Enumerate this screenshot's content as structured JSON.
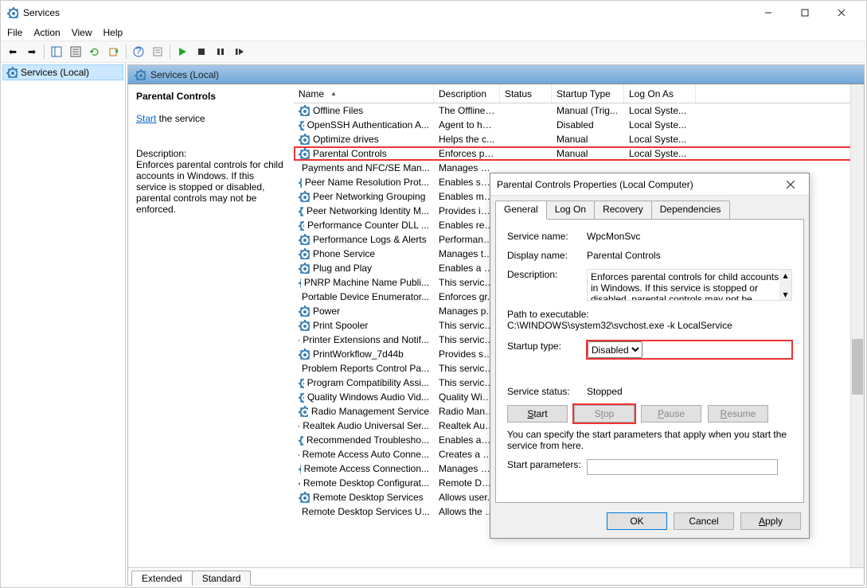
{
  "window": {
    "title": "Services"
  },
  "menu": [
    "File",
    "Action",
    "View",
    "Help"
  ],
  "tree": {
    "root": "Services (Local)"
  },
  "main": {
    "header": "Services (Local)"
  },
  "detail": {
    "title": "Parental Controls",
    "start_link_prefix": "Start",
    "start_link_suffix": " the service",
    "desc_label": "Description:",
    "desc": "Enforces parental controls for child accounts in Windows. If this service is stopped or disabled, parental controls may not be enforced."
  },
  "columns": {
    "name": "Name",
    "desc": "Description",
    "status": "Status",
    "startup": "Startup Type",
    "logon": "Log On As"
  },
  "services": [
    {
      "name": "Offline Files",
      "desc": "The Offline ...",
      "status": "",
      "startup": "Manual (Trig...",
      "logon": "Local Syste..."
    },
    {
      "name": "OpenSSH Authentication A...",
      "desc": "Agent to ho...",
      "status": "",
      "startup": "Disabled",
      "logon": "Local Syste..."
    },
    {
      "name": "Optimize drives",
      "desc": "Helps the c...",
      "status": "",
      "startup": "Manual",
      "logon": "Local Syste..."
    },
    {
      "name": "Parental Controls",
      "desc": "Enforces pa...",
      "status": "",
      "startup": "Manual",
      "logon": "Local Syste...",
      "highlight": true
    },
    {
      "name": "Payments and NFC/SE Man...",
      "desc": "Manages pa...",
      "status": "",
      "startup": "",
      "logon": ""
    },
    {
      "name": "Peer Name Resolution Prot...",
      "desc": "Enables serv...",
      "status": "",
      "startup": "",
      "logon": ""
    },
    {
      "name": "Peer Networking Grouping",
      "desc": "Enables mul...",
      "status": "",
      "startup": "",
      "logon": ""
    },
    {
      "name": "Peer Networking Identity M...",
      "desc": "Provides ide...",
      "status": "",
      "startup": "",
      "logon": ""
    },
    {
      "name": "Performance Counter DLL ...",
      "desc": "Enables rem...",
      "status": "",
      "startup": "",
      "logon": ""
    },
    {
      "name": "Performance Logs & Alerts",
      "desc": "Performanc...",
      "status": "",
      "startup": "",
      "logon": ""
    },
    {
      "name": "Phone Service",
      "desc": "Manages th...",
      "status": "",
      "startup": "",
      "logon": ""
    },
    {
      "name": "Plug and Play",
      "desc": "Enables a c...",
      "status": "",
      "startup": "",
      "logon": ""
    },
    {
      "name": "PNRP Machine Name Publi...",
      "desc": "This service ...",
      "status": "",
      "startup": "",
      "logon": ""
    },
    {
      "name": "Portable Device Enumerator...",
      "desc": "Enforces gr...",
      "status": "",
      "startup": "",
      "logon": ""
    },
    {
      "name": "Power",
      "desc": "Manages p...",
      "status": "",
      "startup": "",
      "logon": ""
    },
    {
      "name": "Print Spooler",
      "desc": "This service ...",
      "status": "",
      "startup": "",
      "logon": ""
    },
    {
      "name": "Printer Extensions and Notif...",
      "desc": "This service ...",
      "status": "",
      "startup": "",
      "logon": ""
    },
    {
      "name": "PrintWorkflow_7d44b",
      "desc": "Provides su...",
      "status": "",
      "startup": "",
      "logon": ""
    },
    {
      "name": "Problem Reports Control Pa...",
      "desc": "This service ...",
      "status": "",
      "startup": "",
      "logon": ""
    },
    {
      "name": "Program Compatibility Assi...",
      "desc": "This service ...",
      "status": "",
      "startup": "",
      "logon": ""
    },
    {
      "name": "Quality Windows Audio Vid...",
      "desc": "Quality Win...",
      "status": "",
      "startup": "",
      "logon": ""
    },
    {
      "name": "Radio Management Service",
      "desc": "Radio Mana...",
      "status": "",
      "startup": "",
      "logon": ""
    },
    {
      "name": "Realtek Audio Universal Ser...",
      "desc": "Realtek Aud...",
      "status": "",
      "startup": "",
      "logon": ""
    },
    {
      "name": "Recommended Troublesho...",
      "desc": "Enables aut...",
      "status": "",
      "startup": "",
      "logon": ""
    },
    {
      "name": "Remote Access Auto Conne...",
      "desc": "Creates a co...",
      "status": "",
      "startup": "",
      "logon": ""
    },
    {
      "name": "Remote Access Connection...",
      "desc": "Manages di...",
      "status": "",
      "startup": "",
      "logon": ""
    },
    {
      "name": "Remote Desktop Configurat...",
      "desc": "Remote Des...",
      "status": "",
      "startup": "",
      "logon": ""
    },
    {
      "name": "Remote Desktop Services",
      "desc": "Allows user...",
      "status": "",
      "startup": "",
      "logon": ""
    },
    {
      "name": "Remote Desktop Services U...",
      "desc": "Allows the r...",
      "status": "",
      "startup": "",
      "logon": ""
    }
  ],
  "bottom_tabs": {
    "extended": "Extended",
    "standard": "Standard"
  },
  "dialog": {
    "title": "Parental Controls Properties (Local Computer)",
    "tabs": [
      "General",
      "Log On",
      "Recovery",
      "Dependencies"
    ],
    "labels": {
      "service_name": "Service name:",
      "display_name": "Display name:",
      "description": "Description:",
      "path_label": "Path to executable:",
      "startup_type": "Startup type:",
      "service_status": "Service status:",
      "params_hint": "You can specify the start parameters that apply when you start the service from here.",
      "start_params": "Start parameters:"
    },
    "values": {
      "service_name": "WpcMonSvc",
      "display_name": "Parental Controls",
      "description": "Enforces parental controls for child accounts in Windows. If this service is stopped or disabled, parental controls may not be enforced.",
      "path": "C:\\WINDOWS\\system32\\svchost.exe -k LocalService",
      "startup_type": "Disabled",
      "status": "Stopped",
      "start_params": ""
    },
    "buttons": {
      "start": "Start",
      "stop": "Stop",
      "pause": "Pause",
      "resume": "Resume",
      "ok": "OK",
      "cancel": "Cancel",
      "apply": "Apply"
    }
  }
}
